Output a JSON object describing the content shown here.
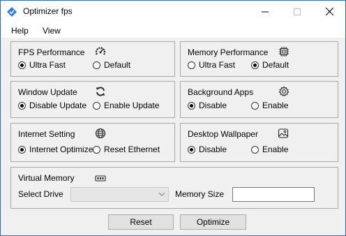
{
  "window": {
    "title": "Optimizer fps"
  },
  "menu": {
    "help": "Help",
    "view": "View"
  },
  "fps": {
    "title": "FPS Performance",
    "opt1": "Ultra Fast",
    "opt2": "Default",
    "selected": "Ultra Fast"
  },
  "memory_perf": {
    "title": "Memory Performance",
    "opt1": "Ultra Fast",
    "opt2": "Default",
    "selected": "Default"
  },
  "window_update": {
    "title": "Window Update",
    "opt1": "Disable Update",
    "opt2": "Enable Update",
    "selected": "Disable Update"
  },
  "background_apps": {
    "title": "Background Apps",
    "opt1": "Disable",
    "opt2": "Enable",
    "selected": "Disable"
  },
  "internet": {
    "title": "Internet Setting",
    "opt1": "Internet Optimize",
    "opt2": "Reset Ethernet",
    "selected": "Internet Optimize"
  },
  "wallpaper": {
    "title": "Desktop Wallpaper",
    "opt1": "Disable",
    "opt2": "Enable",
    "selected": "Disable"
  },
  "virtual_memory": {
    "title": "Virtual Memory",
    "select_drive_label": "Select Drive",
    "drive_value": "",
    "memory_size_label": "Memory Size",
    "memory_size_value": ""
  },
  "buttons": {
    "reset": "Reset",
    "optimize": "Optimize"
  }
}
